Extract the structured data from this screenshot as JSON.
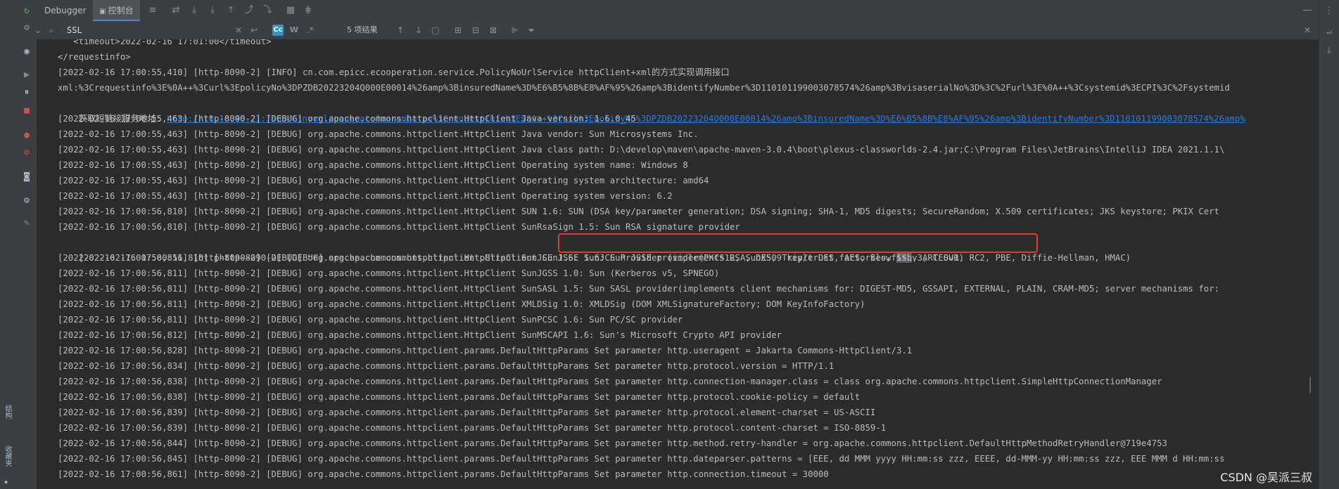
{
  "left_strip": {
    "structure_label": "结构",
    "favorites_label": "收藏夹"
  },
  "tabs": [
    {
      "label": "Debugger",
      "active": false
    },
    {
      "label": "控制台",
      "active": true
    }
  ],
  "search": {
    "value": "SSL",
    "match_count": "5 项结果"
  },
  "console": {
    "lines": [
      {
        "text": "   <timeout>2022-02-16 17:01:00</timeout>",
        "cut": true
      },
      {
        "text": "</requestinfo>"
      },
      {
        "text": "[2022-02-16 17:00:55,410] [http-8090-2] [INFO] cn.com.epicc.ecooperation.service.PolicyNoUrlService httpClient+xml的方式实现调用接口"
      },
      {
        "text": "xml:%3Crequestinfo%3E%0A++%3Curl%3EpolicyNo%3DPZDB20223204Q000E00014%26amp%3BinsuredName%3D%E6%B5%8B%E8%AF%95%26amp%3BidentifyNumber%3D110101199003078574%26amp%3BvisaserialNo%3D%3C%2Furl%3E%0A++%3Csystemid%3ECPI%3C%2Fsystemid"
      },
      {
        "prefix": "获取短链接服务地址: ",
        "link": "http://10.10.40.21:7005/tinyurl/generate?paramData=%3Crequestinfo%3E%0A++%3Curl%3EpolicyNo%3DPZDB20223204Q000E00014%26amp%3BinsuredName%3D%E6%B5%8B%E8%AF%95%26amp%3BidentifyNumber%3D110101199003078574%26amp%"
      },
      {
        "text": "[2022-02-16 17:00:55,463] [http-8090-2] [DEBUG] org.apache.commons.httpclient.HttpClient Java version: 1.6.0_45"
      },
      {
        "text": "[2022-02-16 17:00:55,463] [http-8090-2] [DEBUG] org.apache.commons.httpclient.HttpClient Java vendor: Sun Microsystems Inc."
      },
      {
        "text": "[2022-02-16 17:00:55,463] [http-8090-2] [DEBUG] org.apache.commons.httpclient.HttpClient Java class path: D:\\develop\\maven\\apache-maven-3.0.4\\boot\\plexus-classworlds-2.4.jar;C:\\Program Files\\JetBrains\\IntelliJ IDEA 2021.1.1\\"
      },
      {
        "text": "[2022-02-16 17:00:55,463] [http-8090-2] [DEBUG] org.apache.commons.httpclient.HttpClient Operating system name: Windows 8"
      },
      {
        "text": "[2022-02-16 17:00:55,463] [http-8090-2] [DEBUG] org.apache.commons.httpclient.HttpClient Operating system architecture: amd64"
      },
      {
        "text": "[2022-02-16 17:00:55,463] [http-8090-2] [DEBUG] org.apache.commons.httpclient.HttpClient Operating system version: 6.2"
      },
      {
        "text": "[2022-02-16 17:00:56,810] [http-8090-2] [DEBUG] org.apache.commons.httpclient.HttpClient SUN 1.6: SUN (DSA key/parameter generation; DSA signing; SHA-1, MD5 digests; SecureRandom; X.509 certificates; JKS keystore; PKIX Cert"
      },
      {
        "text": "[2022-02-16 17:00:56,810] [http-8090-2] [DEBUG] org.apache.commons.httpclient.HttpClient SunRsaSign 1.5: Sun RSA signature provider"
      },
      {
        "before": "[2022-02-16 17:00:56,810] [http-8090-2] [DEBUG] org.apache.commons.httpclient.HttpClient SunJSSE 1.6: Sun JSSE provider(PKCS12, SunX509 key/trust factories, ",
        "match": "SSL",
        "after": "v3, TLSv1)"
      },
      {
        "text": "[2022-02-16 17:00:56,811] [http-8090-2] [DEBUG] org.apache.commons.httpclient.HttpClient SunJCE 1.6: SunJCE Provider (implements RSA, DES, Triple DES, AES, Blowfish, ARCFOUR, RC2, PBE, Diffie-Hellman, HMAC)"
      },
      {
        "text": "[2022-02-16 17:00:56,811] [http-8090-2] [DEBUG] org.apache.commons.httpclient.HttpClient SunJGSS 1.0: Sun (Kerberos v5, SPNEGO)"
      },
      {
        "text": "[2022-02-16 17:00:56,811] [http-8090-2] [DEBUG] org.apache.commons.httpclient.HttpClient SunSASL 1.5: Sun SASL provider(implements client mechanisms for: DIGEST-MD5, GSSAPI, EXTERNAL, PLAIN, CRAM-MD5; server mechanisms for:"
      },
      {
        "text": "[2022-02-16 17:00:56,811] [http-8090-2] [DEBUG] org.apache.commons.httpclient.HttpClient XMLDSig 1.0: XMLDSig (DOM XMLSignatureFactory; DOM KeyInfoFactory)"
      },
      {
        "text": "[2022-02-16 17:00:56,811] [http-8090-2] [DEBUG] org.apache.commons.httpclient.HttpClient SunPCSC 1.6: Sun PC/SC provider"
      },
      {
        "text": "[2022-02-16 17:00:56,812] [http-8090-2] [DEBUG] org.apache.commons.httpclient.HttpClient SunMSCAPI 1.6: Sun's Microsoft Crypto API provider"
      },
      {
        "text": "[2022-02-16 17:00:56,828] [http-8090-2] [DEBUG] org.apache.commons.httpclient.params.DefaultHttpParams Set parameter http.useragent = Jakarta Commons-HttpClient/3.1"
      },
      {
        "text": "[2022-02-16 17:00:56,834] [http-8090-2] [DEBUG] org.apache.commons.httpclient.params.DefaultHttpParams Set parameter http.protocol.version = HTTP/1.1"
      },
      {
        "text": "[2022-02-16 17:00:56,838] [http-8090-2] [DEBUG] org.apache.commons.httpclient.params.DefaultHttpParams Set parameter http.connection-manager.class = class org.apache.commons.httpclient.SimpleHttpConnectionManager"
      },
      {
        "text": "[2022-02-16 17:00:56,838] [http-8090-2] [DEBUG] org.apache.commons.httpclient.params.DefaultHttpParams Set parameter http.protocol.cookie-policy = default"
      },
      {
        "text": "[2022-02-16 17:00:56,839] [http-8090-2] [DEBUG] org.apache.commons.httpclient.params.DefaultHttpParams Set parameter http.protocol.element-charset = US-ASCII"
      },
      {
        "text": "[2022-02-16 17:00:56,839] [http-8090-2] [DEBUG] org.apache.commons.httpclient.params.DefaultHttpParams Set parameter http.protocol.content-charset = ISO-8859-1"
      },
      {
        "text": "[2022-02-16 17:00:56,844] [http-8090-2] [DEBUG] org.apache.commons.httpclient.params.DefaultHttpParams Set parameter http.method.retry-handler = org.apache.commons.httpclient.DefaultHttpMethodRetryHandler@719e4753"
      },
      {
        "text": "[2022-02-16 17:00:56,845] [http-8090-2] [DEBUG] org.apache.commons.httpclient.params.DefaultHttpParams Set parameter http.dateparser.patterns = [EEE, dd MMM yyyy HH:mm:ss zzz, EEEE, dd-MMM-yy HH:mm:ss zzz, EEE MMM d HH:mm:ss"
      },
      {
        "text": "[2022-02-16 17:00:56,861] [http-8090-2] [DEBUG] org.apache.commons.httpclient.params.DefaultHttpParams Set parameter http.connection.timeout = 30000"
      }
    ]
  },
  "watermark": "CSDN @吴派三叔"
}
